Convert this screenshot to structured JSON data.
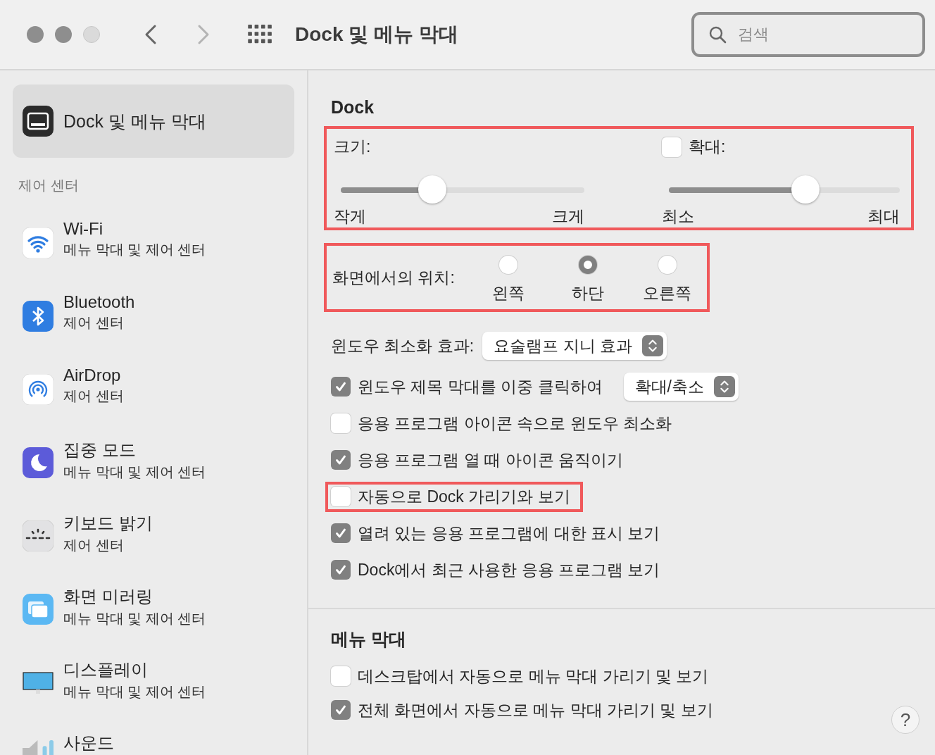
{
  "window": {
    "title": "Dock 및 메뉴 막대",
    "search": {
      "placeholder": "검색"
    }
  },
  "sidebar": {
    "items": [
      {
        "title": "Dock 및 메뉴 막대",
        "kind": "dock",
        "selected": true
      }
    ],
    "section_title": "제어 센터",
    "section_items": [
      {
        "title": "Wi-Fi",
        "subtitle": "메뉴 막대 및 제어 센터",
        "kind": "wifi",
        "selected": false
      },
      {
        "title": "Bluetooth",
        "subtitle": "제어 센터",
        "kind": "bluetooth",
        "selected": false
      },
      {
        "title": "AirDrop",
        "subtitle": "제어 센터",
        "kind": "airdrop",
        "selected": false
      },
      {
        "title": "집중 모드",
        "subtitle": "메뉴 막대 및 제어 센터",
        "kind": "focus",
        "selected": false
      },
      {
        "title": "키보드 밝기",
        "subtitle": "제어 센터",
        "kind": "keyboard",
        "selected": false
      },
      {
        "title": "화면 미러링",
        "subtitle": "메뉴 막대 및 제어 센터",
        "kind": "mirroring",
        "selected": false
      },
      {
        "title": "디스플레이",
        "subtitle": "메뉴 막대 및 제어 센터",
        "kind": "display",
        "selected": false
      },
      {
        "title": "사운드",
        "kind": "sound",
        "selected": false
      }
    ]
  },
  "dock": {
    "title": "Dock",
    "sliders_highlighted": true,
    "size": {
      "label": "크기:",
      "level": 0.376,
      "min_label": "작게",
      "max_label": "크게"
    },
    "magnification": {
      "label": "확대:",
      "checked": false,
      "level": 0.59,
      "min_label": "최소",
      "max_label": "최대"
    },
    "position": {
      "label": "화면에서의 위치:",
      "highlighted": true,
      "options": [
        {
          "label": "왼쪽",
          "selected": false
        },
        {
          "label": "하단",
          "selected": true
        },
        {
          "label": "오른쪽",
          "selected": false
        }
      ]
    },
    "minimize_effect": {
      "label": "윈도우 최소화 효과:",
      "value": "요술램프 지니 효과"
    },
    "options": [
      {
        "label": "윈도우 제목 막대를 이중 클릭하여",
        "checked": true,
        "highlighted": false,
        "popup": "확대/축소"
      },
      {
        "label": "응용 프로그램 아이콘 속으로 윈도우 최소화",
        "checked": false,
        "highlighted": false
      },
      {
        "label": "응용 프로그램 열 때 아이콘 움직이기",
        "checked": true,
        "highlighted": false
      },
      {
        "label": "자동으로 Dock 가리기와 보기",
        "checked": false,
        "highlighted": true
      },
      {
        "label": "열려 있는 응용 프로그램에 대한 표시 보기",
        "checked": true,
        "highlighted": false
      },
      {
        "label": "Dock에서 최근 사용한 응용 프로그램 보기",
        "checked": true,
        "highlighted": false
      }
    ]
  },
  "menu_bar": {
    "title": "메뉴 막대",
    "options": [
      {
        "label": "데스크탑에서 자동으로 메뉴 막대 가리기 및 보기",
        "checked": false
      },
      {
        "label": "전체 화면에서 자동으로 메뉴 막대 가리기 및 보기",
        "checked": true
      }
    ]
  },
  "help_button": "?"
}
